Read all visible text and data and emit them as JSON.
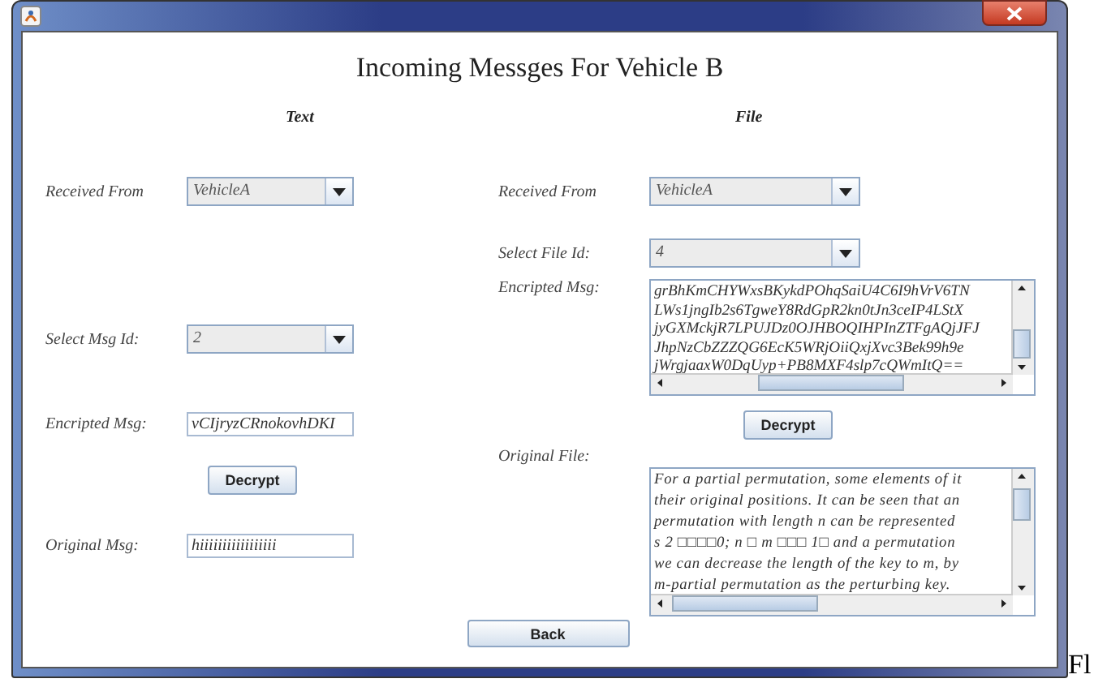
{
  "heading": "Incoming Messges For Vehicle B",
  "text_panel": {
    "header": "Text",
    "received_from": {
      "label": "Received From",
      "value": "VehicleA"
    },
    "msg_id": {
      "label": "Select Msg Id:",
      "value": "2"
    },
    "encrypted": {
      "label": "Encripted Msg:",
      "value": "vCIjryzCRnokovhDKI"
    },
    "decrypt_button": "Decrypt",
    "original": {
      "label": "Original Msg:",
      "value": "hiiiiiiiiiiiiiiiii"
    }
  },
  "file_panel": {
    "header": "File",
    "received_from": {
      "label": "Received From",
      "value": "VehicleA"
    },
    "file_id": {
      "label": "Select File Id:",
      "value": "4"
    },
    "encrypted": {
      "label": "Encripted Msg:",
      "lines": [
        "grBhKmCHYWxsBKykdPOhqSaiU4C6I9hVrV6TN",
        "LWs1jngIb2s6TgweY8RdGpR2kn0tJn3ceIP4LStX",
        "jyGXMckjR7LPUJDz0OJHBOQIHPInZTFgAQjJFJ",
        "JhpNzCbZZZQG6EcK5WRjOiiQxjXvc3Bek99h9e",
        "jWrgjaaxW0DqUyp+PB8MXF4slp7cQWmItQ=="
      ]
    },
    "decrypt_button": "Decrypt",
    "original": {
      "label": "Original File:",
      "lines": [
        "For a partial permutation, some elements of it",
        "their original positions. It can be seen that an",
        "permutation with length n can be represented",
        "s 2 □□□□0; n □ m □□□ 1□ and a permutation",
        "we can decrease the length of the key to m, by",
        "m-partial permutation as the perturbing key."
      ]
    }
  },
  "back_button": "Back",
  "outside_fragment": "Fl"
}
